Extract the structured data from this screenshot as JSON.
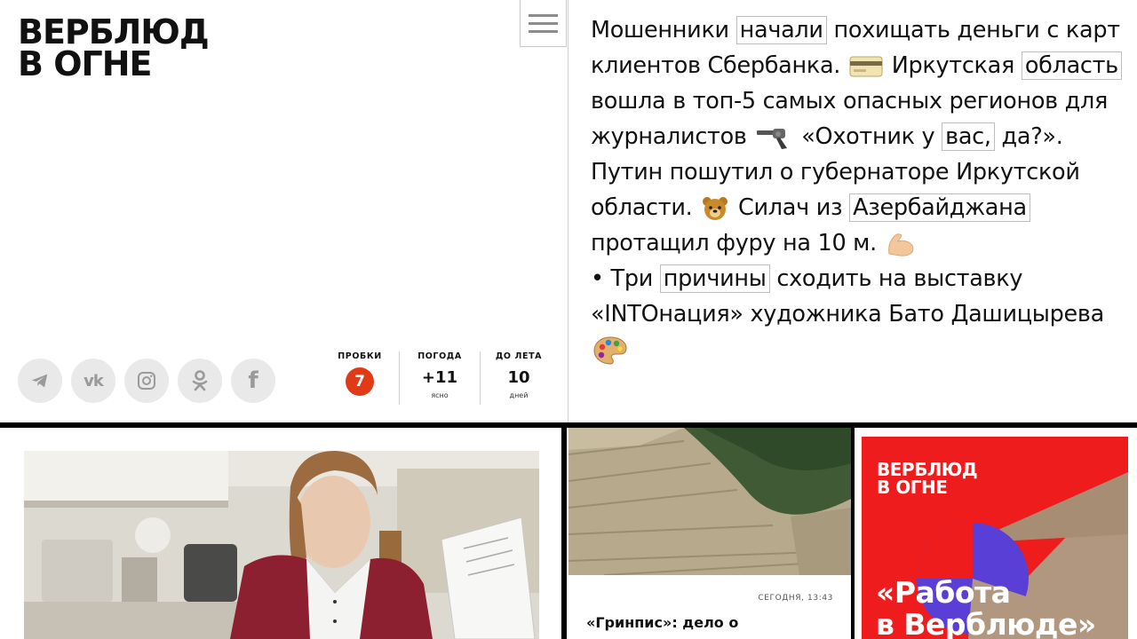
{
  "brand": {
    "logo_line1": "ВЕРБЛЮД",
    "logo_line2": "В ОГНЕ"
  },
  "header": {
    "menu_icon": "hamburger-icon"
  },
  "socials": [
    {
      "name": "telegram",
      "icon": "telegram-icon"
    },
    {
      "name": "vk",
      "icon": "vk-icon",
      "label": "vk"
    },
    {
      "name": "instagram",
      "icon": "instagram-icon"
    },
    {
      "name": "odnoklassniki",
      "icon": "ok-icon"
    },
    {
      "name": "facebook",
      "icon": "facebook-icon",
      "label": "f"
    }
  ],
  "info": {
    "traffic": {
      "label": "ПРОБКИ",
      "value": "7",
      "color": "#e03a17"
    },
    "weather": {
      "label": "ПОГОДА",
      "value": "+11",
      "sub": "ясно"
    },
    "summer": {
      "label": "ДО ЛЕТА",
      "value": "10",
      "sub": "дней"
    }
  },
  "digest": {
    "t1": "Мошенники",
    "k1": "начали",
    "t2": "похищать деньги с карт клиентов Сбербанка.",
    "t3": "Иркутская",
    "k2": "область",
    "t4": "вошла в топ-5 самых опасных регионов для журналистов",
    "t5": "«Охотник у",
    "k3": "вас,",
    "t6": "да?». Путин пошутил о губернаторе Иркутской области.",
    "t7": "Силач из",
    "k4": "Азербайджана",
    "t8": "протащил фуру на 10 м.",
    "t9": "• Три",
    "k5": "причины",
    "t10": "сходить на выставку «INTОнация» художника Бато Дашицырева"
  },
  "news_card": {
    "time": "СЕГОДНЯ, 13:43",
    "title": "«Гринпис»: дело о"
  },
  "promo": {
    "logo_line1": "ВЕРБЛЮД",
    "logo_line2": "В ОГНЕ",
    "title_line1": "«Работа",
    "title_line2": "в Верблюде»"
  },
  "colors": {
    "accent_red": "#ee1c1c",
    "badge": "#e03a17",
    "divider": "#000000"
  }
}
